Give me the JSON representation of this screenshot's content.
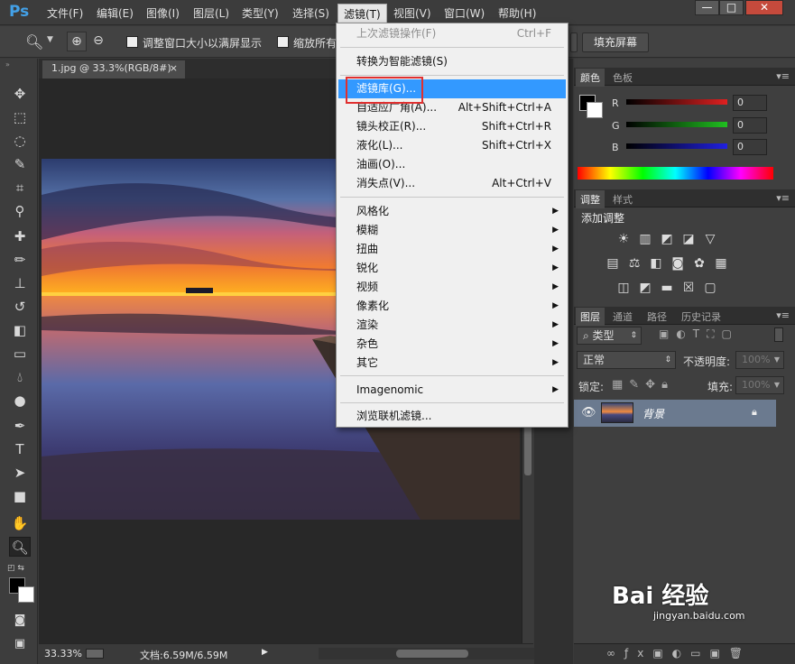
{
  "app": {
    "logo": "Ps"
  },
  "menubar": {
    "items": [
      "文件(F)",
      "编辑(E)",
      "图像(I)",
      "图层(L)",
      "类型(Y)",
      "选择(S)",
      "滤镜(T)",
      "视图(V)",
      "窗口(W)",
      "帮助(H)"
    ],
    "window_buttons": [
      "—",
      "□",
      "✕"
    ]
  },
  "options": {
    "check1_label": "调整窗口大小以满屏显示",
    "check2_label": "缩放所有",
    "fill_screen_btn": "填充屏幕"
  },
  "document": {
    "tab_title": "1.jpg @ 33.3%(RGB/8#)",
    "tab_close": "×",
    "zoom": "33.33%",
    "doc_size": "文档:6.59M/6.59M"
  },
  "filter_menu": {
    "items": [
      {
        "label": "上次滤镜操作(F)",
        "shortcut": "Ctrl+F",
        "state": "disabled"
      },
      {
        "label": "转换为智能滤镜(S)",
        "shortcut": "",
        "state": "normal"
      },
      {
        "label": "滤镜库(G)...",
        "shortcut": "",
        "state": "highlighted"
      },
      {
        "label": "自适应广角(A)...",
        "shortcut": "Alt+Shift+Ctrl+A",
        "state": "normal"
      },
      {
        "label": "镜头校正(R)...",
        "shortcut": "Shift+Ctrl+R",
        "state": "normal"
      },
      {
        "label": "液化(L)...",
        "shortcut": "Shift+Ctrl+X",
        "state": "normal"
      },
      {
        "label": "油画(O)...",
        "shortcut": "",
        "state": "normal"
      },
      {
        "label": "消失点(V)...",
        "shortcut": "Alt+Ctrl+V",
        "state": "normal"
      },
      {
        "label": "风格化",
        "shortcut": "",
        "state": "submenu"
      },
      {
        "label": "模糊",
        "shortcut": "",
        "state": "submenu"
      },
      {
        "label": "扭曲",
        "shortcut": "",
        "state": "submenu"
      },
      {
        "label": "锐化",
        "shortcut": "",
        "state": "submenu"
      },
      {
        "label": "视频",
        "shortcut": "",
        "state": "submenu"
      },
      {
        "label": "像素化",
        "shortcut": "",
        "state": "submenu"
      },
      {
        "label": "渲染",
        "shortcut": "",
        "state": "submenu"
      },
      {
        "label": "杂色",
        "shortcut": "",
        "state": "submenu"
      },
      {
        "label": "其它",
        "shortcut": "",
        "state": "submenu"
      },
      {
        "label": "Imagenomic",
        "shortcut": "",
        "state": "submenu"
      },
      {
        "label": "浏览联机滤镜...",
        "shortcut": "",
        "state": "normal"
      }
    ]
  },
  "color_panel": {
    "tabs": [
      "颜色",
      "色板"
    ],
    "channels": [
      {
        "label": "R",
        "value": "0",
        "color": "#e02020"
      },
      {
        "label": "G",
        "value": "0",
        "color": "#20c020"
      },
      {
        "label": "B",
        "value": "0",
        "color": "#2020e0"
      }
    ]
  },
  "adjust_panel": {
    "tabs": [
      "调整",
      "样式"
    ],
    "title": "添加调整"
  },
  "layers_panel": {
    "tabs": [
      "图层",
      "通道",
      "路径",
      "历史记录"
    ],
    "filter_label": "类型",
    "blend_mode": "正常",
    "opacity_label": "不透明度:",
    "opacity_value": "100%",
    "lock_label": "锁定:",
    "fill_label": "填充:",
    "fill_value": "100%",
    "layer_name": "背景"
  },
  "watermark": {
    "brand": "Bai 经验",
    "url": "jingyan.baidu.com"
  }
}
